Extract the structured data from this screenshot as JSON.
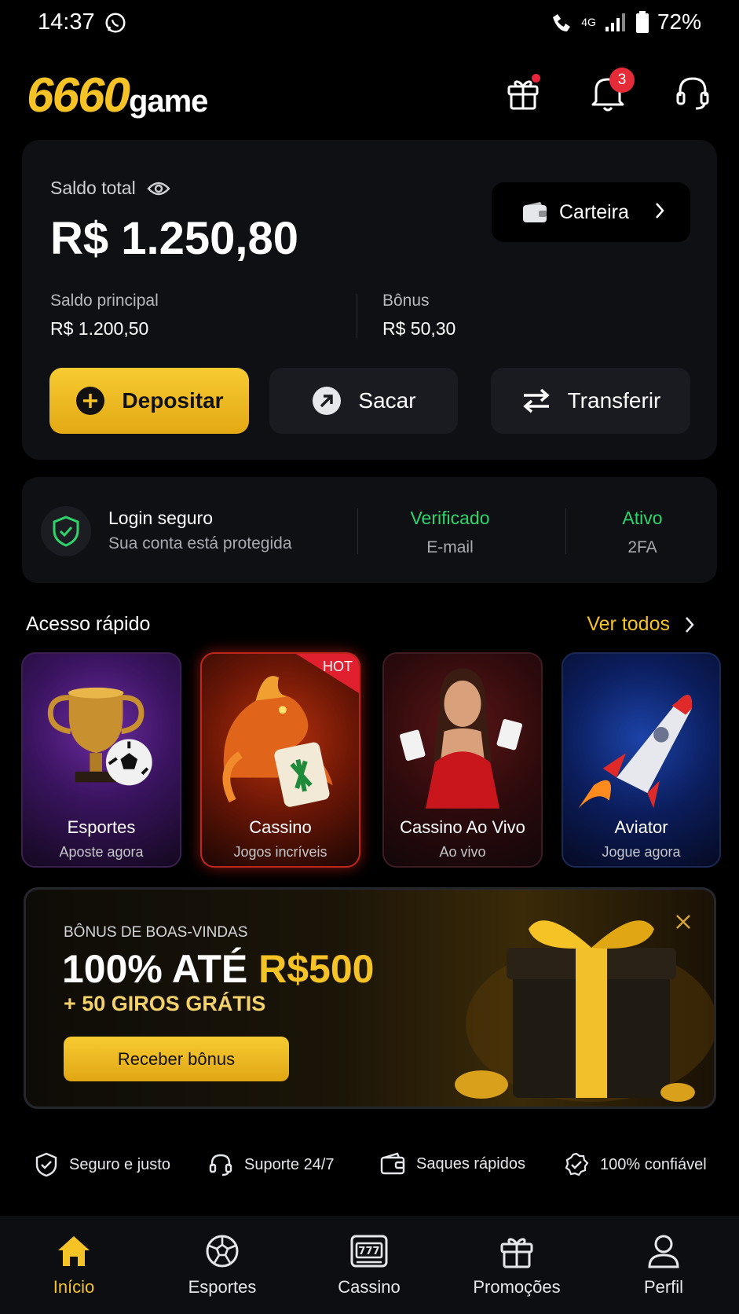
{
  "status_bar": {
    "time": "14:37",
    "battery": "72%",
    "network": "4G"
  },
  "header": {
    "logo_number": "6660",
    "logo_word": "game",
    "notifications_count": "3"
  },
  "balance": {
    "label": "Saldo total",
    "amount": "R$ 1.250,80",
    "wallet_label": "Carteira",
    "main_label": "Saldo principal",
    "main_value": "R$ 1.200,50",
    "bonus_label": "Bônus",
    "bonus_value": "R$ 50,30",
    "actions": {
      "deposit": "Depositar",
      "withdraw": "Sacar",
      "transfer": "Transferir"
    }
  },
  "security": {
    "title": "Login seguro",
    "subtitle": "Sua conta está protegida",
    "stats": [
      {
        "value": "Verificado",
        "label": "E-mail"
      },
      {
        "value": "Ativo",
        "label": "2FA"
      }
    ]
  },
  "quick_access": {
    "title": "Acesso rápido",
    "see_all": "Ver todos",
    "hot_badge": "HOT",
    "tiles": [
      {
        "name": "Esportes",
        "sub": "Aposte agora"
      },
      {
        "name": "Cassino",
        "sub": "Jogos incríveis"
      },
      {
        "name": "Cassino Ao Vivo",
        "sub": "Ao vivo"
      },
      {
        "name": "Aviator",
        "sub": "Jogue agora"
      }
    ]
  },
  "bonus": {
    "pre": "BÔNUS DE BOAS-VINDAS",
    "main_prefix": "100% ATÉ ",
    "main_amount": "R$500",
    "giros": "+ 50 GIROS GRÁTIS",
    "button": "Receber bônus"
  },
  "features": [
    {
      "label": "Seguro e justo",
      "icon": "shield-check-icon"
    },
    {
      "label": "Suporte 24/7",
      "icon": "headset-icon"
    },
    {
      "label": "Saques rápidos",
      "icon": "wallet-icon"
    },
    {
      "label": "100% confiável",
      "icon": "badge-check-icon"
    }
  ],
  "nav": [
    {
      "label": "Início",
      "icon": "home-icon",
      "active": true
    },
    {
      "label": "Esportes",
      "icon": "soccer-ball-icon"
    },
    {
      "label": "Cassino",
      "icon": "slot-machine-icon"
    },
    {
      "label": "Promoções",
      "icon": "gift-icon"
    },
    {
      "label": "Perfil",
      "icon": "user-icon"
    }
  ],
  "colors": {
    "accent": "#f5c325",
    "success": "#2fd56b",
    "badge": "#e52a38",
    "background": "#000000",
    "card": "#0f1014"
  }
}
